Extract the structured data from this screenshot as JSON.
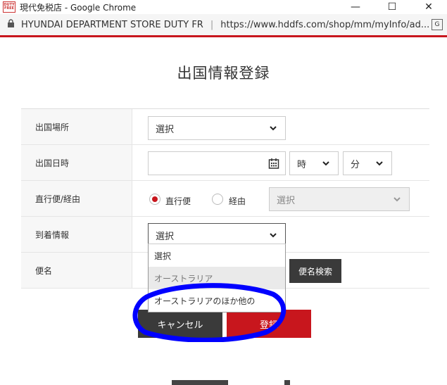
{
  "window": {
    "favicon_text": "DUTY FREE",
    "title": "現代免税店 - Google Chrome",
    "minimize": "—",
    "maximize": "☐",
    "close": "✕"
  },
  "address_bar": {
    "site_name": "HYUNDAI DEPARTMENT STORE DUTY FR",
    "separator": "|",
    "url": "https://www.hddfs.com/shop/mm/myInfo/ad...",
    "translate_icon": "translate-icon"
  },
  "page": {
    "title": "出国情報登録"
  },
  "form": {
    "departure_place": {
      "label": "出国場所",
      "value": "選択"
    },
    "departure_datetime": {
      "label": "出国日時",
      "date_value": "",
      "hour_value": "時",
      "minute_value": "分"
    },
    "flight_type": {
      "label": "直行便/経由",
      "option_direct": "直行便",
      "option_transit": "経由",
      "transit_select": "選択",
      "selected": "direct"
    },
    "arrival_info": {
      "label": "到着情報",
      "value": "選択"
    },
    "flight_name": {
      "label": "便名",
      "search_button": "便名検索"
    }
  },
  "dropdown": {
    "items": [
      {
        "label": "選択"
      },
      {
        "label": "オーストラリア"
      },
      {
        "label": "オーストラリアのほか他の"
      }
    ]
  },
  "actions": {
    "cancel": "キャンセル",
    "register": "登録"
  },
  "colors": {
    "brand_red": "#c8161d",
    "annotation_blue": "#0000ff",
    "dark_button": "#3a3a3a"
  }
}
